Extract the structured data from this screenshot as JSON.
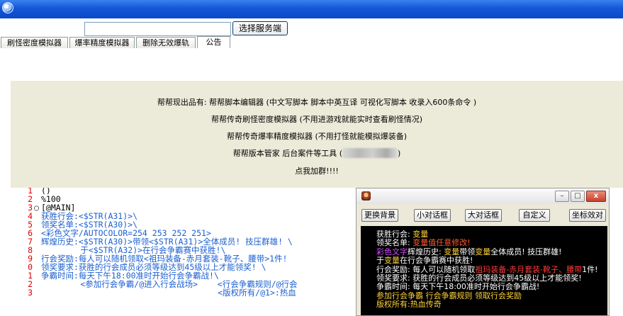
{
  "window": {
    "icon": "app-globe-icon"
  },
  "server_bar": {
    "input_value": "",
    "select_button": "选择服务端"
  },
  "tabs": [
    "刷怪密度模拟器",
    "爆率精度模拟器",
    "删除无效爆轨",
    "公告"
  ],
  "notice": {
    "line1": "帮帮现出品有:   帮帮脚本编辑器 (中文写脚本  脚本中英互译  可视化写脚本  收录入600条命令  )",
    "line2": "帮帮传奇刷怪密度模拟器 (不用进游戏就能实时查看刷怪情况)",
    "line3": "帮帮传奇爆率精度模拟器 (不用打怪就能模拟爆装备)",
    "line4a": "帮帮版本管家  后台案件等工具 (",
    "line4b": ")",
    "line5": "点我加群!!!!"
  },
  "editor": {
    "lines": [
      {
        "num": "1",
        "fold": "",
        "text": "()",
        "color": "#000000"
      },
      {
        "num": "2",
        "fold": "",
        "text": "%100",
        "color": "#000000"
      },
      {
        "num": "3",
        "fold": "○",
        "text": "[@MAIN]",
        "color": "#000000"
      },
      {
        "num": "4",
        "fold": "",
        "text": "获胜行会:<$STR(A31)>\\",
        "color": "#1a5fd0"
      },
      {
        "num": "5",
        "fold": "",
        "text": "领奖名单:<$STR(A30)>\\",
        "color": "#1a5fd0"
      },
      {
        "num": "6",
        "fold": "",
        "text": "<彩色文字/AUTOCOLOR=254 253 252 251>",
        "color": "#1a5fd0"
      },
      {
        "num": "7",
        "fold": "",
        "text": "辉煌历史:<$STR(A30)>带领<$STR(A31)>全体成员! 技压群雄! \\",
        "color": "#1a5fd0"
      },
      {
        "num": "8",
        "fold": "",
        "text": "        于<$STR(A32)>在行会争霸赛中获胜!\\",
        "color": "#1a5fd0"
      },
      {
        "num": "9",
        "fold": "",
        "text": "行会奖励:每人可以随机领取<祖玛装备-赤月套装-靴子、腰带>1件!",
        "color": "#1a5fd0"
      },
      {
        "num": "0",
        "fold": "",
        "text": "领奖要求:获胜的行会成员必须等级达到45级以上才能领奖! \\",
        "color": "#1a5fd0"
      },
      {
        "num": "1",
        "fold": "",
        "text": "争霸时间:每天下午18:00准时开始行会争霸战!\\",
        "color": "#1a5fd0"
      },
      {
        "num": "2",
        "fold": "",
        "text": "        <参加行会争霸/@进入行会战场>    <行会争霸规则/@行会",
        "color": "#1a5fd0"
      },
      {
        "num": "3",
        "fold": "",
        "text": "                                    <版权所有/@1>:热血",
        "color": "#1a5fd0"
      }
    ]
  },
  "preview": {
    "icon": "app-character-icon",
    "controls": {
      "minimize": "–",
      "maximize": "□",
      "close": "x"
    },
    "buttons": [
      "更换背景",
      "小对话框",
      "大对话框",
      "自定义",
      "坐标效对"
    ],
    "lines": [
      {
        "segments": [
          {
            "text": "获胜行会: ",
            "color": "#ffffff"
          },
          {
            "text": "变量",
            "color": "#ffd23a"
          }
        ]
      },
      {
        "segments": [
          {
            "text": "领奖名单: ",
            "color": "#ffffff"
          },
          {
            "text": "变量值任意修改!",
            "color": "#ff5c33"
          }
        ]
      },
      {
        "segments": [
          {
            "text": "彩色文字",
            "color": "#d54bff"
          },
          {
            "text": "辉煌历史: ",
            "color": "#ffffff"
          },
          {
            "text": "变量",
            "color": "#ffd23a"
          },
          {
            "text": "带领",
            "color": "#ffffff"
          },
          {
            "text": "变量",
            "color": "#ffd23a"
          },
          {
            "text": "全体成员! 技压群雄!",
            "color": "#ffffff"
          }
        ]
      },
      {
        "segments": [
          {
            "text": "于",
            "color": "#ffffff"
          },
          {
            "text": "变量",
            "color": "#ffd23a"
          },
          {
            "text": "在行会争霸赛中获胜!",
            "color": "#ffffff"
          }
        ]
      },
      {
        "segments": [
          {
            "text": "行会奖励: 每人可以随机领取",
            "color": "#ffffff"
          },
          {
            "text": "祖玛装备-赤月套装-靴子、腰带",
            "color": "#ff3b3b"
          },
          {
            "text": "1件!",
            "color": "#ffffff"
          }
        ]
      },
      {
        "segments": [
          {
            "text": "领奖要求: 获胜的行会成员必须等级达到45级以上才能领奖!",
            "color": "#ffffff"
          }
        ]
      },
      {
        "segments": [
          {
            "text": "争霸时间: 每天下午18:00准时开始行会争霸战!",
            "color": "#ffffff"
          }
        ]
      },
      {
        "segments": [
          {
            "text": "参加行会争霸",
            "color": "#ffd23a"
          },
          {
            "text": "      ",
            "color": "#ffffff"
          },
          {
            "text": "行会争霸规则",
            "color": "#ffd23a"
          },
          {
            "text": "      ",
            "color": "#ffffff"
          },
          {
            "text": "领取行会奖励",
            "color": "#ffd23a"
          }
        ]
      },
      {
        "segments": [
          {
            "text": "版权所有:热血传奇",
            "color": "#ffd23a"
          }
        ]
      }
    ]
  }
}
